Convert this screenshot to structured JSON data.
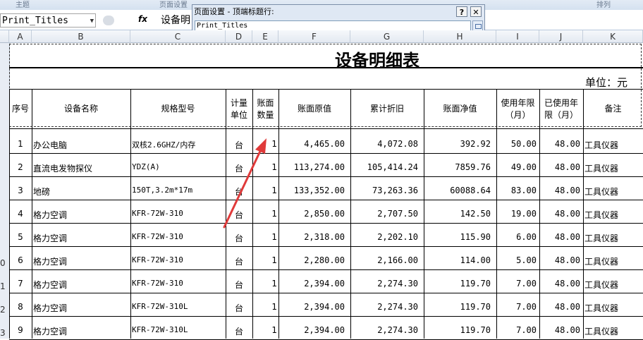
{
  "ribbon": {
    "groups": [
      "主题",
      "页面设置",
      "排列"
    ]
  },
  "formula_bar": {
    "name_box": "Print_Titles",
    "fx": "fx",
    "content": "设备明"
  },
  "dialog": {
    "title": "页面设置 - 顶端标题行:",
    "help": "?",
    "close": "✕",
    "input_value": "Print_Titles"
  },
  "columns": [
    "A",
    "B",
    "C",
    "D",
    "E",
    "F",
    "G",
    "H",
    "I",
    "J",
    "K"
  ],
  "row_numbers": [
    "0",
    "1",
    "2",
    "3"
  ],
  "sheet": {
    "title": "设备明细表",
    "unit": "单位：元",
    "headers": [
      "序号",
      "设备名称",
      "规格型号",
      "计量单位",
      "账面数量",
      "账面原值",
      "累计折旧",
      "账面净值",
      "使用年限（月）",
      "已使用年限（月）",
      "备注"
    ],
    "rows": [
      [
        "1",
        "办公电脑",
        "双核2.6GHZ/内存",
        "台",
        "1",
        "4,465.00",
        "4,072.08",
        "392.92",
        "50.00",
        "48.00",
        "工具仪器"
      ],
      [
        "2",
        "直流电发物探仪",
        "YDZ(A)",
        "台",
        "1",
        "113,274.00",
        "105,414.24",
        "7859.76",
        "49.00",
        "48.00",
        "工具仪器"
      ],
      [
        "3",
        "地磅",
        "150T,3.2m*17m",
        "台",
        "1",
        "133,352.00",
        "73,263.36",
        "60088.64",
        "83.00",
        "48.00",
        "工具仪器"
      ],
      [
        "4",
        "格力空调",
        "KFR-72W-310",
        "台",
        "1",
        "2,850.00",
        "2,707.50",
        "142.50",
        "19.00",
        "48.00",
        "工具仪器"
      ],
      [
        "5",
        "格力空调",
        "KFR-72W-310",
        "台",
        "1",
        "2,318.00",
        "2,202.10",
        "115.90",
        "6.00",
        "48.00",
        "工具仪器"
      ],
      [
        "6",
        "格力空调",
        "KFR-72W-310",
        "台",
        "1",
        "2,280.00",
        "2,166.00",
        "114.00",
        "5.00",
        "48.00",
        "工具仪器"
      ],
      [
        "7",
        "格力空调",
        "KFR-72W-310",
        "台",
        "1",
        "2,394.00",
        "2,274.30",
        "119.70",
        "7.00",
        "48.00",
        "工具仪器"
      ],
      [
        "8",
        "格力空调",
        "KFR-72W-310L",
        "台",
        "1",
        "2,394.00",
        "2,274.30",
        "119.70",
        "7.00",
        "48.00",
        "工具仪器"
      ],
      [
        "9",
        "格力空调",
        "KFR-72W-310L",
        "台",
        "1",
        "2,394.00",
        "2,274.30",
        "119.70",
        "7.00",
        "48.00",
        "工具仪器"
      ]
    ]
  },
  "annotation": {
    "arrow_color": "#e03a3a"
  }
}
